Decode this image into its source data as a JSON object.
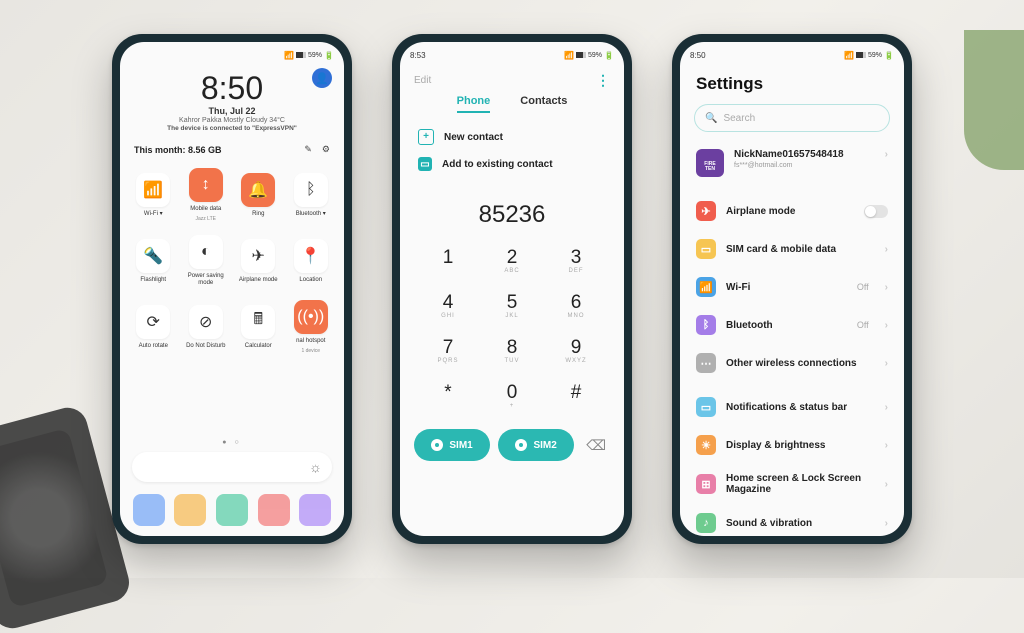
{
  "status": {
    "time1": "",
    "time2": "8:53",
    "time3": "8:50",
    "battery": "59%"
  },
  "qs": {
    "time": "8:50",
    "date": "Thu, Jul 22",
    "weather": "Kahror Pakka Mostly Cloudy 34°C",
    "vpn": "The device is connected to \"ExpressVPN\"",
    "data_label": "This month: 8.56 GB",
    "tiles": [
      {
        "icon": "wifi",
        "label": "Wi-Fi ▾",
        "active": false
      },
      {
        "icon": "data",
        "label": "Mobile data",
        "sub": "Jazz LTE",
        "active": true
      },
      {
        "icon": "ring",
        "label": "Ring",
        "active": true
      },
      {
        "icon": "bt",
        "label": "Bluetooth ▾",
        "active": false
      },
      {
        "icon": "flash",
        "label": "Flashlight",
        "active": false
      },
      {
        "icon": "power",
        "label": "Power saving mode",
        "active": false
      },
      {
        "icon": "plane",
        "label": "Airplane mode",
        "active": false
      },
      {
        "icon": "loc",
        "label": "Location",
        "active": false
      },
      {
        "icon": "rotate",
        "label": "Auto rotate",
        "active": false
      },
      {
        "icon": "dnd",
        "label": "Do Not Disturb",
        "active": false
      },
      {
        "icon": "calc",
        "label": "Calculator",
        "active": false
      },
      {
        "icon": "hotspot",
        "label": "nal hotspot",
        "sub": "1 device",
        "active": true
      }
    ]
  },
  "dialer": {
    "edit": "Edit",
    "tabs": {
      "phone": "Phone",
      "contacts": "Contacts"
    },
    "new_contact": "New contact",
    "add_existing": "Add to existing contact",
    "number": "85236",
    "keys": [
      {
        "n": "1",
        "s": ""
      },
      {
        "n": "2",
        "s": "ABC"
      },
      {
        "n": "3",
        "s": "DEF"
      },
      {
        "n": "4",
        "s": "GHI"
      },
      {
        "n": "5",
        "s": "JKL"
      },
      {
        "n": "6",
        "s": "MNO"
      },
      {
        "n": "7",
        "s": "PQRS"
      },
      {
        "n": "8",
        "s": "TUV"
      },
      {
        "n": "9",
        "s": "WXYZ"
      },
      {
        "n": "*",
        "s": ""
      },
      {
        "n": "0",
        "s": "+"
      },
      {
        "n": "#",
        "s": ""
      }
    ],
    "sim1": "SIM1",
    "sim2": "SIM2"
  },
  "settings": {
    "title": "Settings",
    "search_placeholder": "Search",
    "profile": {
      "name": "NickName01657548418",
      "email": "fs***@hotmail.com"
    },
    "items": [
      {
        "icon": "air",
        "label": "Airplane mode",
        "control": "toggle"
      },
      {
        "icon": "sim",
        "label": "SIM card & mobile data",
        "control": "chev"
      },
      {
        "icon": "wifi",
        "label": "Wi-Fi",
        "value": "Off",
        "control": "chev"
      },
      {
        "icon": "bt",
        "label": "Bluetooth",
        "value": "Off",
        "control": "chev"
      },
      {
        "icon": "other",
        "label": "Other wireless connections",
        "control": "chev"
      },
      {
        "sep": true
      },
      {
        "icon": "notif",
        "label": "Notifications & status bar",
        "control": "chev"
      },
      {
        "icon": "disp",
        "label": "Display & brightness",
        "control": "chev"
      },
      {
        "icon": "home",
        "label": "Home screen & Lock Screen Magazine",
        "control": "chev"
      },
      {
        "icon": "sound",
        "label": "Sound & vibration",
        "control": "chev"
      }
    ]
  }
}
